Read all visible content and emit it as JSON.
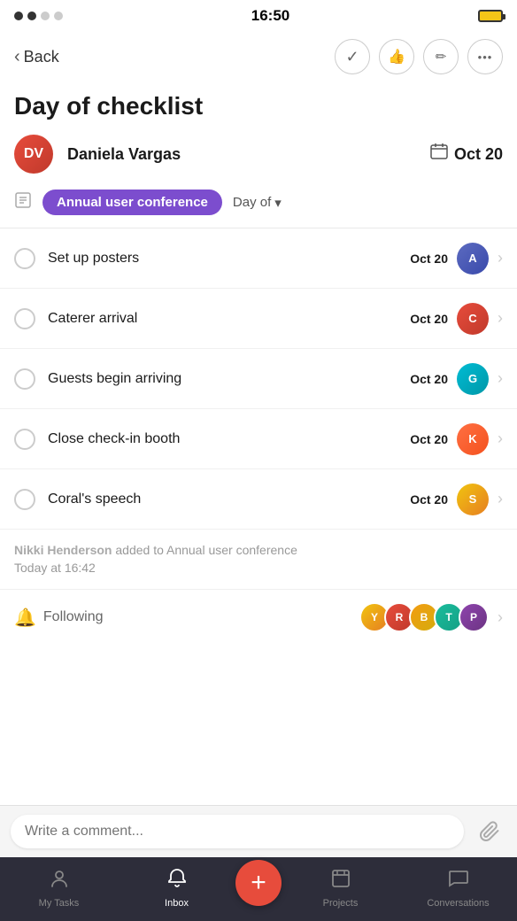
{
  "statusBar": {
    "time": "16:50",
    "dots": [
      "filled",
      "filled",
      "empty",
      "empty"
    ]
  },
  "header": {
    "back_label": "Back",
    "actions": [
      {
        "name": "check-icon",
        "symbol": "✓"
      },
      {
        "name": "thumbs-up-icon",
        "symbol": "👍"
      },
      {
        "name": "edit-icon",
        "symbol": "✏"
      },
      {
        "name": "more-icon",
        "symbol": "···"
      }
    ]
  },
  "page": {
    "title": "Day of checklist",
    "assignee": "Daniela Vargas",
    "date": "Oct 20",
    "tag": "Annual user conference",
    "day_of_label": "Day of"
  },
  "tasks": [
    {
      "name": "Set up posters",
      "date": "Oct 20",
      "avatar_color": "av-indigo",
      "initials": "A"
    },
    {
      "name": "Caterer arrival",
      "date": "Oct 20",
      "avatar_color": "av-red",
      "initials": "C"
    },
    {
      "name": "Guests begin arriving",
      "date": "Oct 20",
      "avatar_color": "av-cyan",
      "initials": "G"
    },
    {
      "name": "Close check-in booth",
      "date": "Oct 20",
      "avatar_color": "av-orange",
      "initials": "K"
    },
    {
      "name": "Coral's speech",
      "date": "Oct 20",
      "avatar_color": "av-yellow",
      "initials": "S"
    }
  ],
  "activity": {
    "text": "Nikki Henderson added to Annual user conference",
    "timestamp": "Today at 16:42"
  },
  "following": {
    "label": "Following",
    "avatars": [
      {
        "color": "av-yellow",
        "initials": "Y"
      },
      {
        "color": "av-red",
        "initials": "R"
      },
      {
        "color": "av-blonde",
        "initials": "B"
      },
      {
        "color": "av-teal",
        "initials": "T"
      },
      {
        "color": "av-purple",
        "initials": "P"
      }
    ]
  },
  "comment": {
    "placeholder": "Write a comment..."
  },
  "bottomNav": [
    {
      "label": "My Tasks",
      "icon": "👤",
      "active": false
    },
    {
      "label": "Inbox",
      "icon": "🔔",
      "active": true
    },
    {
      "label": "",
      "icon": "+",
      "fab": true
    },
    {
      "label": "Projects",
      "icon": "📋",
      "active": false
    },
    {
      "label": "Conversations",
      "icon": "💬",
      "active": false
    }
  ]
}
